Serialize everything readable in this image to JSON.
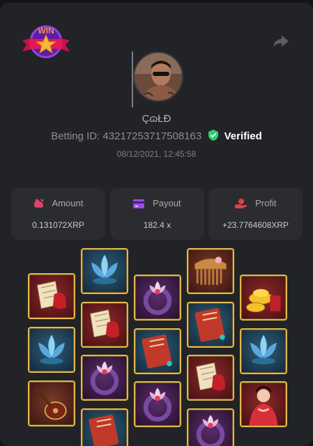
{
  "badge": {
    "text": "WIN"
  },
  "user": {
    "name": "ÇɷŁĐ",
    "betting_id_label": "Betting ID:",
    "betting_id": "43217253717508163",
    "verified_label": "Verified",
    "datetime": "08/12/2021, 12:45:58"
  },
  "stats": [
    {
      "label": "Amount",
      "value": "0.131072XRP",
      "icon": "money-bag-icon",
      "color": "#e0406b"
    },
    {
      "label": "Payout",
      "value": "182.4 x",
      "icon": "wallet-card-icon",
      "color": "#9b4be8"
    },
    {
      "label": "Profit",
      "value": "+23.7764608XRP",
      "icon": "hand-coin-icon",
      "color": "#e0404a"
    }
  ],
  "colors": {
    "frame": "#e2b94a",
    "verified": "#2ecc71",
    "card": "#222326"
  },
  "reels": [
    [
      "scroll-fan",
      "lotus",
      "instrument"
    ],
    [
      "lotus",
      "scroll-fan",
      "lotus-ring",
      "red-book"
    ],
    [
      "lotus-ring",
      "red-book",
      "lotus-ring"
    ],
    [
      "comb",
      "red-book",
      "scroll-fan",
      "lotus-ring"
    ],
    [
      "gold-ingots",
      "lotus",
      "maiden"
    ]
  ]
}
